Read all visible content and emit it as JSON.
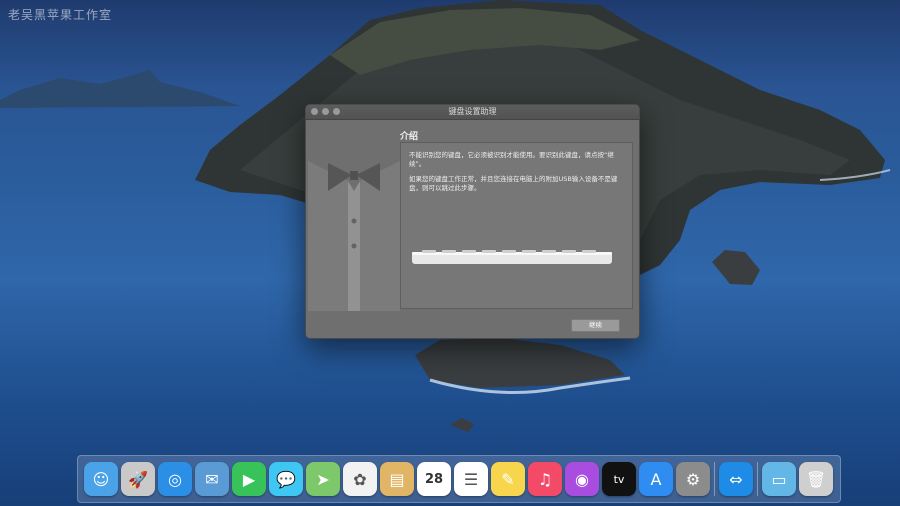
{
  "watermark": "老吴黑苹果工作室",
  "dialog": {
    "title": "键盘设置助理",
    "heading": "介绍",
    "paragraph1": "不能识别您的键盘，它必须被识别才能使用。要识别此键盘，请点按“继续”。",
    "paragraph2": "如果您的键盘工作正常，并且您连接在电脑上的附加USB输入设备不是键盘，则可以跳过此步骤。",
    "continue_label": "继续"
  },
  "dock": {
    "apps": [
      {
        "name": "finder-icon",
        "glyph": "☺",
        "color": "#4aa3e8"
      },
      {
        "name": "launchpad-icon",
        "glyph": "🚀",
        "color": "#c9c9c9"
      },
      {
        "name": "safari-icon",
        "glyph": "◎",
        "color": "#2b8fe6"
      },
      {
        "name": "mail-icon",
        "glyph": "✉",
        "color": "#5a9bd6"
      },
      {
        "name": "facetime-icon",
        "glyph": "▶",
        "color": "#37c35a"
      },
      {
        "name": "messages-icon",
        "glyph": "💬",
        "color": "#3fc7f3"
      },
      {
        "name": "maps-icon",
        "glyph": "➤",
        "color": "#7dc86b"
      },
      {
        "name": "photos-icon",
        "glyph": "✿",
        "color": "#f2f2f2"
      },
      {
        "name": "notes-app-icon",
        "glyph": "▤",
        "color": "#e0b565"
      },
      {
        "name": "calendar-icon",
        "glyph": "28",
        "color": "#ffffff"
      },
      {
        "name": "reminders-icon",
        "glyph": "☰",
        "color": "#ffffff"
      },
      {
        "name": "notes-icon",
        "glyph": "✎",
        "color": "#f7d54c"
      },
      {
        "name": "music-icon",
        "glyph": "♫",
        "color": "#f34a68"
      },
      {
        "name": "podcasts-icon",
        "glyph": "◉",
        "color": "#a94de0"
      },
      {
        "name": "apple-tv-icon",
        "glyph": "tv",
        "color": "#111111"
      },
      {
        "name": "app-store-icon",
        "glyph": "A",
        "color": "#2f8cf0"
      },
      {
        "name": "system-preferences-icon",
        "glyph": "⚙",
        "color": "#8c8c8c"
      },
      {
        "name": "teamviewer-icon",
        "glyph": "⇔",
        "color": "#1e8be6"
      },
      {
        "name": "downloads-folder-icon",
        "glyph": "▭",
        "color": "#63b7e6"
      },
      {
        "name": "trash-icon",
        "glyph": "🗑",
        "color": "#cfcfcf"
      }
    ]
  }
}
